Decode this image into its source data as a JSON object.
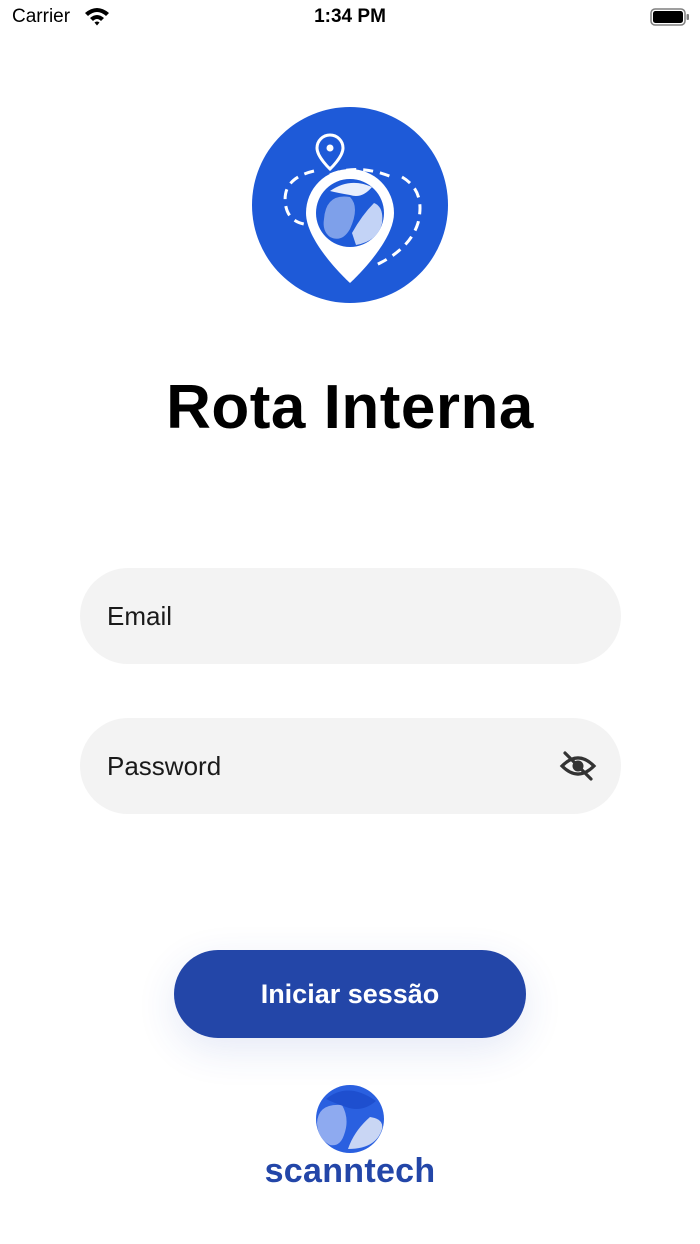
{
  "status_bar": {
    "carrier": "Carrier",
    "time": "1:34 PM",
    "icons": [
      "wifi-icon",
      "battery-icon"
    ]
  },
  "app": {
    "title": "Rota Interna",
    "logo_icon": "location-pin-logo"
  },
  "form": {
    "email_placeholder": "Email",
    "password_placeholder": "Password",
    "password_toggle_icon": "eye-slash-icon",
    "submit_label": "Iniciar sessão"
  },
  "footer": {
    "brand": "scanntech",
    "brand_logo_icon": "scanntech-logo"
  },
  "colors": {
    "primary": "#2346a8",
    "logo_background": "#1e5ad8",
    "field_background": "#f3f3f3"
  }
}
